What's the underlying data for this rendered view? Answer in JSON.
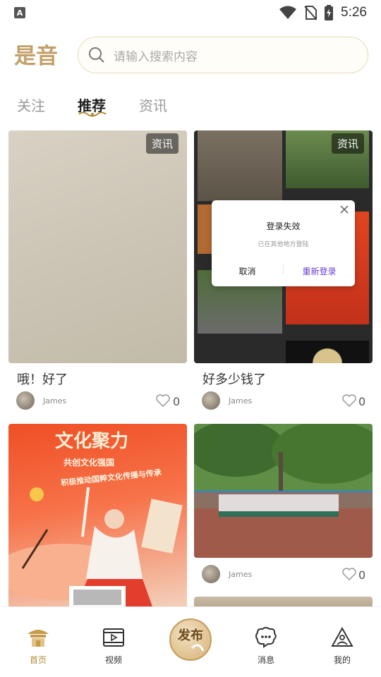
{
  "status_bar": {
    "time": "5:26",
    "indicator_letter": "A"
  },
  "header": {
    "logo_text": "是音",
    "search_placeholder": "请输入搜索内容"
  },
  "tabs": [
    {
      "label": "关注",
      "active": false
    },
    {
      "label": "推荐",
      "active": true
    },
    {
      "label": "资讯",
      "active": false
    }
  ],
  "feed": [
    {
      "title": "哦！好了",
      "badge": "资讯",
      "author": "James",
      "likes": "0"
    },
    {
      "title": "好多少钱了",
      "badge": "资讯",
      "author": "James",
      "likes": "0"
    },
    {
      "title": "",
      "badge": "",
      "author": "",
      "likes": ""
    },
    {
      "title": "",
      "badge": "",
      "author": "James",
      "likes": "0"
    }
  ],
  "poster": {
    "headline": "文化聚力",
    "line1": "共创文化强国",
    "line2": "积极推动国粹文化传播与传承"
  },
  "dialog": {
    "title": "登录失效",
    "message": "已在其他地方登陆",
    "cancel": "取消",
    "relogin": "重新登录"
  },
  "bottom_nav": [
    {
      "label": "首页",
      "icon": "pavilion-icon",
      "active": true
    },
    {
      "label": "视频",
      "icon": "video-icon",
      "active": false
    },
    {
      "label": "发布",
      "icon": "publish-icon",
      "active": false
    },
    {
      "label": "消息",
      "icon": "chat-icon",
      "active": false
    },
    {
      "label": "我的",
      "icon": "profile-icon",
      "active": false
    }
  ],
  "colors": {
    "accent": "#b58a3a",
    "dialog_primary": "#6a3dd6"
  }
}
